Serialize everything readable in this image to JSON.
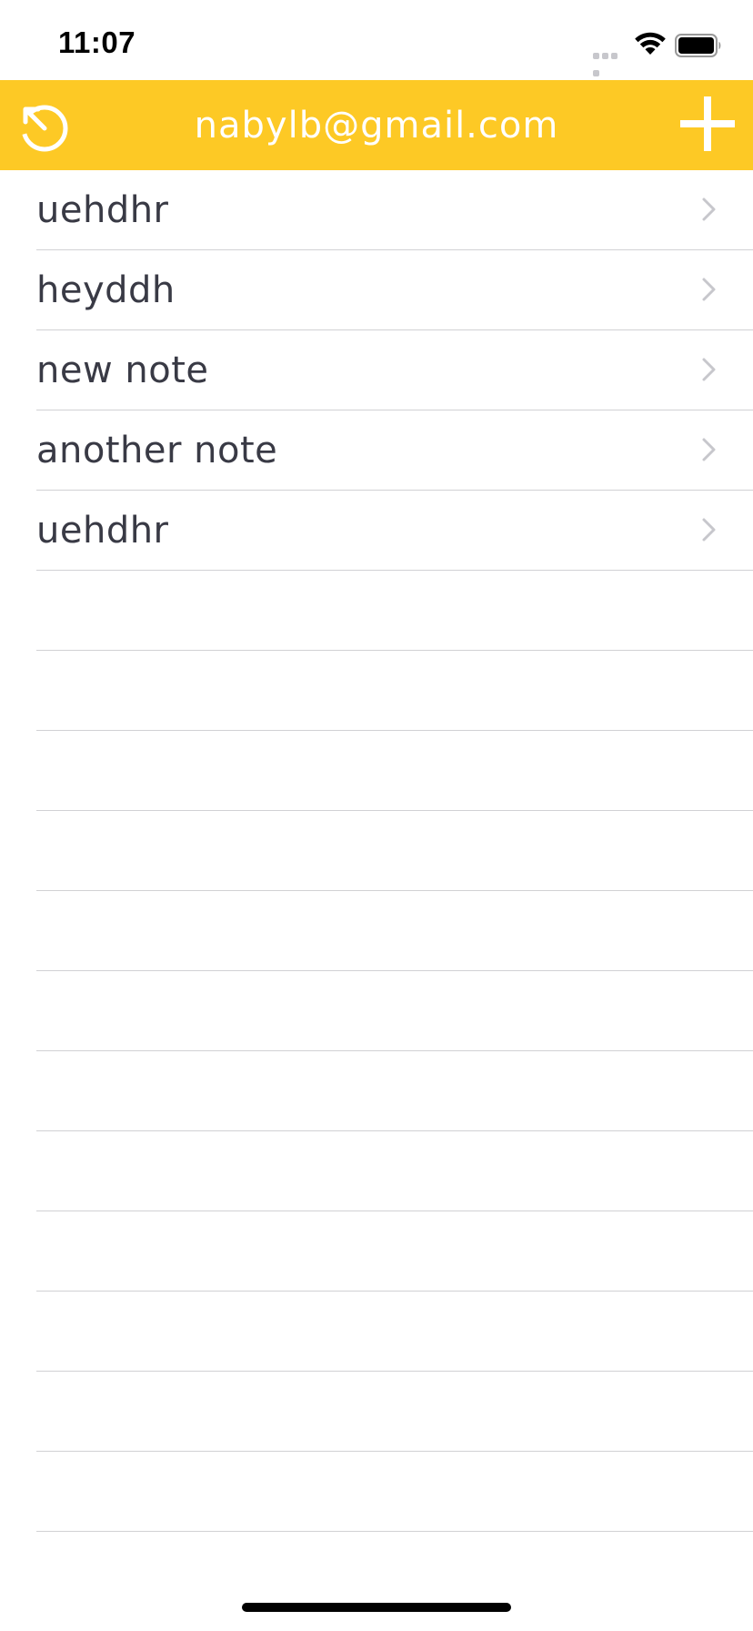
{
  "status_bar": {
    "time": "11:07",
    "icons": [
      "signal-icon",
      "wifi-icon",
      "battery-icon"
    ]
  },
  "nav_bar": {
    "title": "nabylb@gmail.com",
    "left_icon": "logout-icon",
    "right_icon": "plus-icon",
    "background_color": "#fdc925"
  },
  "notes": [
    {
      "title": "uehdhr"
    },
    {
      "title": "heyddh"
    },
    {
      "title": "new note"
    },
    {
      "title": "another note"
    },
    {
      "title": "uehdhr"
    }
  ],
  "colors": {
    "accent": "#fdc925",
    "text": "#393a45",
    "separator": "#d1d1d4",
    "chevron": "#c7c7cc"
  }
}
